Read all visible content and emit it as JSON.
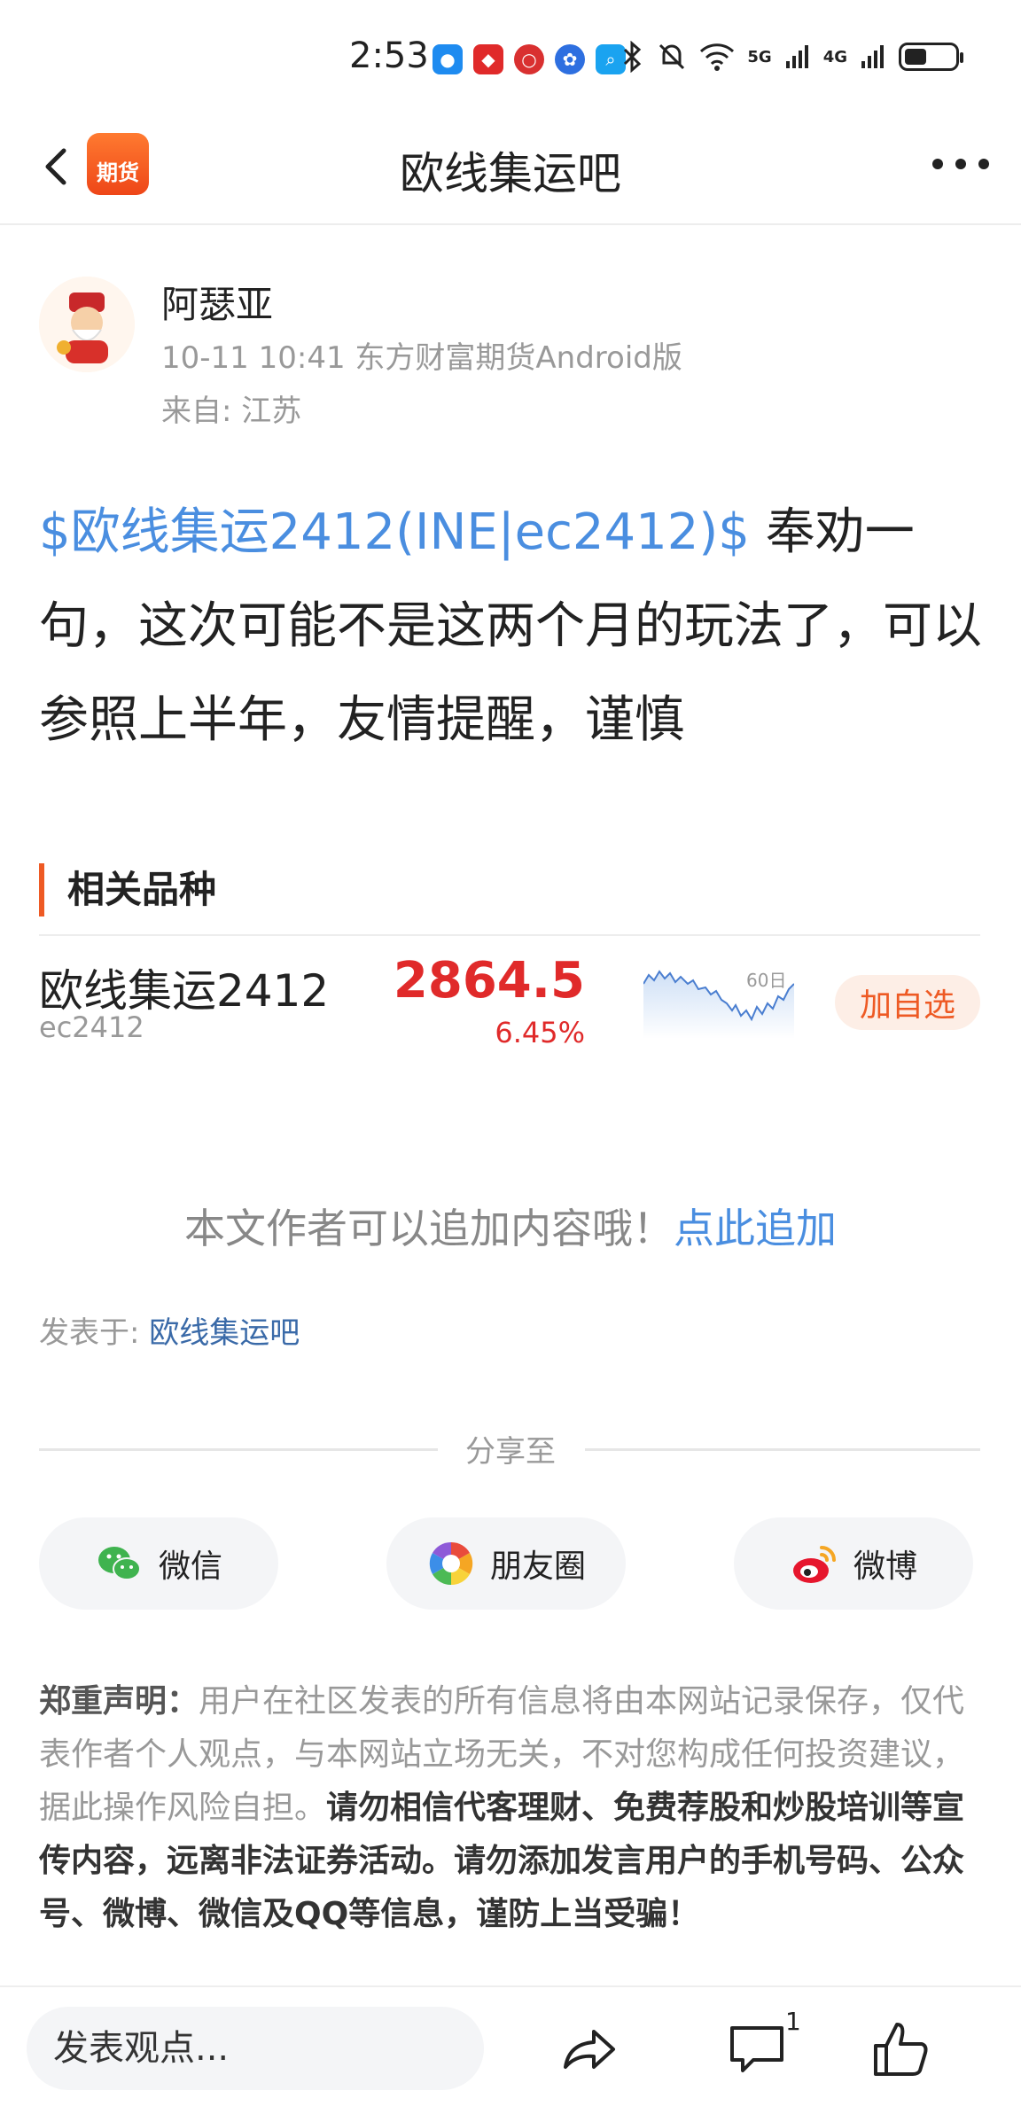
{
  "status": {
    "time": "2:53",
    "network_labels": [
      "5G",
      "4G"
    ]
  },
  "nav": {
    "logo_text": "期货",
    "title": "欧线集运吧"
  },
  "author": {
    "name": "阿瑟亚",
    "meta": "10-11 10:41 东方财富期货Android版",
    "location": "来自: 江苏"
  },
  "post": {
    "tag": "$欧线集运2412(INE|ec2412)$",
    "text": " 奉劝一句，这次可能不是这两个月的玩法了，可以参照上半年，友情提醒，谨慎"
  },
  "related": {
    "title": "相关品种",
    "item": {
      "name": "欧线集运2412",
      "code": "ec2412",
      "price": "2864.5",
      "change_pct": "6.45%",
      "chart_label": "60日",
      "add_label": "加自选"
    }
  },
  "append": {
    "text": "本文作者可以追加内容哦！",
    "link": "点此追加"
  },
  "posted_in": {
    "label": "发表于: ",
    "link": "欧线集运吧"
  },
  "share": {
    "title": "分享至",
    "buttons": [
      {
        "label": "微信",
        "icon": "wechat-icon"
      },
      {
        "label": "朋友圈",
        "icon": "moments-icon"
      },
      {
        "label": "微博",
        "icon": "weibo-icon"
      }
    ]
  },
  "disclaimer": {
    "label": "郑重声明",
    "colon": "：",
    "normal": "用户在社区发表的所有信息将由本网站记录保存，仅代表作者个人观点，与本网站立场无关，不对您构成任何投资建议，据此操作风险自担。",
    "strong": "请勿相信代客理财、免费荐股和炒股培训等宣传内容，远离非法证券活动。请勿添加发言用户的手机号码、公众号、微博、微信及QQ等信息，谨防上当受骗！"
  },
  "bottom": {
    "placeholder": "发表观点...",
    "comment_count": "1"
  },
  "colors": {
    "accent": "#ee5a24",
    "link": "#4a8ee0",
    "up": "#e02a2a"
  }
}
